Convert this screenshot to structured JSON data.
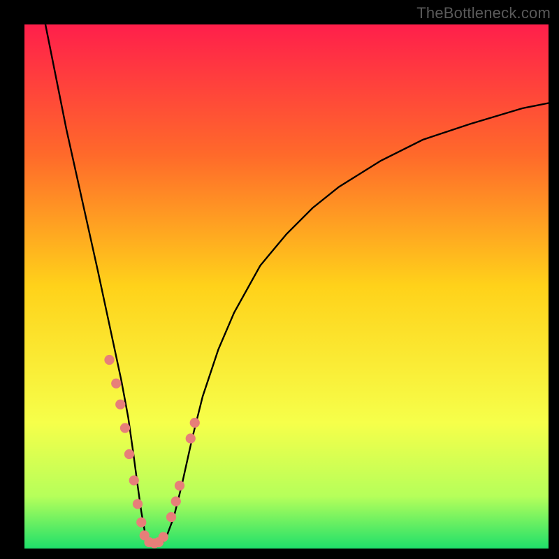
{
  "watermark": {
    "text": "TheBottleneck.com"
  },
  "gradient": {
    "stops": [
      "#ff1f4b",
      "#ff6a2a",
      "#ffd21a",
      "#f6ff4a",
      "#b6ff5a",
      "#1fe06a"
    ]
  },
  "chart_data": {
    "type": "line",
    "title": "",
    "xlabel": "",
    "ylabel": "",
    "xlim": [
      0,
      100
    ],
    "ylim": [
      0,
      100
    ],
    "grid": false,
    "series": [
      {
        "name": "bottleneck-curve",
        "color": "#000000",
        "x": [
          4,
          6,
          8,
          10,
          12,
          14,
          15.5,
          17,
          18.5,
          19.8,
          20.8,
          21.6,
          22.3,
          23,
          24,
          25,
          26,
          27,
          28.5,
          30,
          32,
          34,
          37,
          40,
          45,
          50,
          55,
          60,
          68,
          76,
          85,
          95,
          100
        ],
        "y": [
          100,
          90,
          80,
          71,
          62,
          53,
          46,
          39,
          32,
          25,
          18,
          12,
          7,
          3,
          0.8,
          0.4,
          0.7,
          2,
          6,
          12,
          21,
          29,
          38,
          45,
          54,
          60,
          65,
          69,
          74,
          78,
          81,
          84,
          85
        ]
      }
    ],
    "markers": {
      "name": "dots",
      "color": "#e77f79",
      "radius_domain": 0.95,
      "x": [
        16.2,
        17.5,
        18.3,
        19.2,
        20.0,
        20.9,
        21.6,
        22.3,
        22.9,
        23.8,
        24.8,
        25.6,
        26.5,
        28.0,
        28.9,
        29.6,
        31.7,
        32.5
      ],
      "y": [
        36.0,
        31.5,
        27.5,
        23.0,
        18.0,
        13.0,
        8.5,
        5.0,
        2.5,
        1.2,
        1.0,
        1.2,
        2.2,
        6.0,
        9.0,
        12.0,
        21.0,
        24.0
      ]
    }
  }
}
